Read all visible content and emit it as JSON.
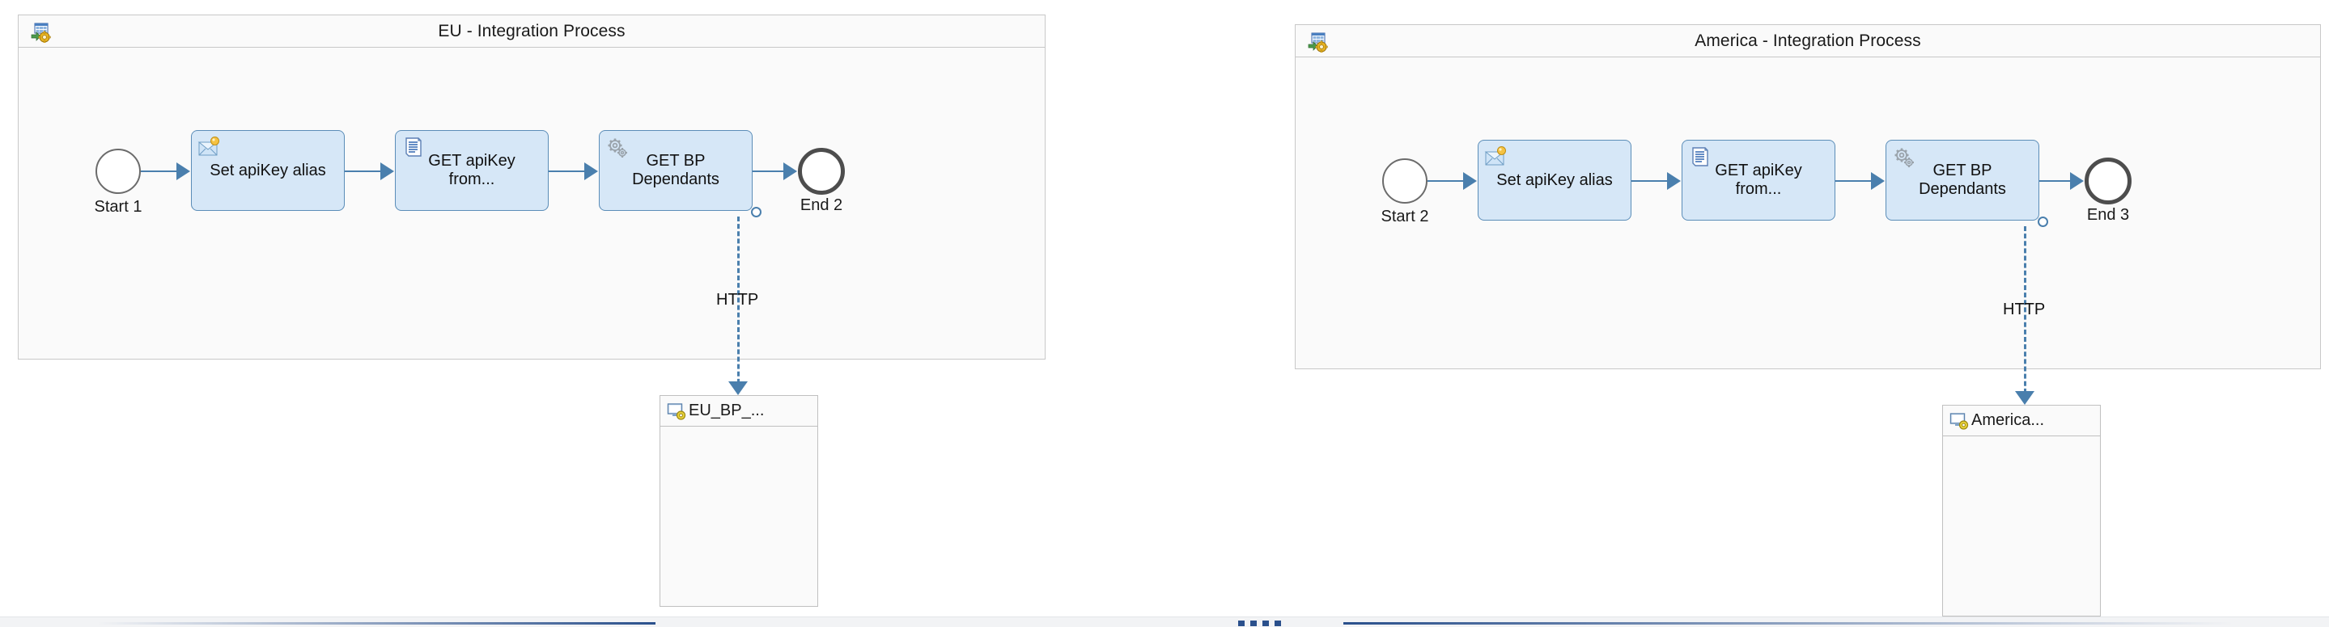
{
  "canvas": {
    "background": "#ffffff",
    "accent_color": "#4a7fad",
    "task_fill": "#d6e7f7",
    "task_border": "#5b8db8",
    "pool_fill": "#fafafa",
    "pool_border": "#c8c8c8"
  },
  "pools": [
    {
      "id": "eu",
      "title": "EU - Integration Process",
      "icon": "integration-process-icon",
      "start_event": {
        "label": "Start 1",
        "icon": "start-event-icon"
      },
      "tasks": [
        {
          "label": "Set apiKey alias",
          "icon": "content-modifier-icon"
        },
        {
          "label": "GET apiKey\nfrom...",
          "icon": "script-icon"
        },
        {
          "label": "GET BP\nDependants",
          "icon": "process-call-icon"
        }
      ],
      "end_event": {
        "label": "End 2",
        "icon": "end-event-icon"
      },
      "message_flow": {
        "label": "HTTP"
      },
      "participant": {
        "title": "EU_BP_...",
        "icon": "receiver-system-icon"
      }
    },
    {
      "id": "america",
      "title": "America - Integration Process",
      "icon": "integration-process-icon",
      "start_event": {
        "label": "Start 2",
        "icon": "start-event-icon"
      },
      "tasks": [
        {
          "label": "Set apiKey alias",
          "icon": "content-modifier-icon"
        },
        {
          "label": "GET apiKey\nfrom...",
          "icon": "script-icon"
        },
        {
          "label": "GET BP\nDependants",
          "icon": "process-call-icon"
        }
      ],
      "end_event": {
        "label": "End 3",
        "icon": "end-event-icon"
      },
      "message_flow": {
        "label": "HTTP"
      },
      "participant": {
        "title": "America...",
        "icon": "receiver-system-icon"
      }
    }
  ],
  "splitter": {
    "name": "horizontal-splitter",
    "color": "#2a508c"
  }
}
